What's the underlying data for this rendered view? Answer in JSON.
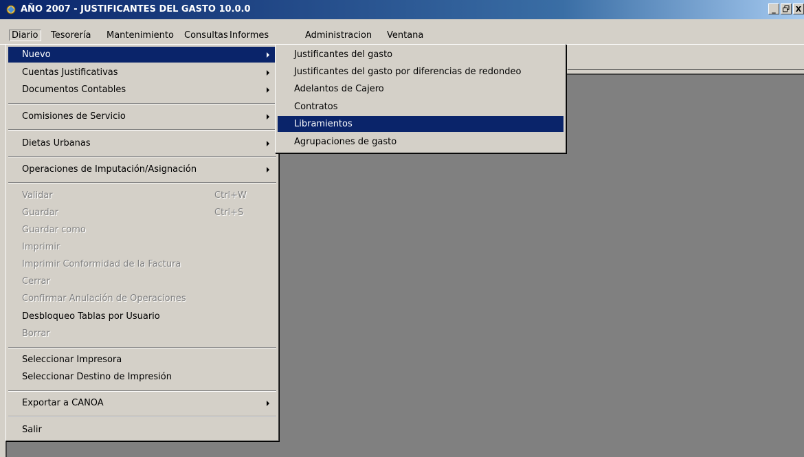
{
  "window": {
    "title": "AÑO 2007 - JUSTIFICANTES DEL GASTO 10.0.0",
    "controls": [
      "_",
      "И",
      "X"
    ]
  },
  "menubar": {
    "items": [
      "Diario",
      "Tesorería",
      "Mantenimiento",
      "Consultas",
      "Informes",
      "Administracion",
      "Ventana"
    ]
  },
  "diario_menu": {
    "items": [
      {
        "label": "Nuevo",
        "submenu": true,
        "selected": true
      },
      {
        "label": "Cuentas Justificativas",
        "submenu": true
      },
      {
        "label": "Documentos Contables",
        "submenu": true
      },
      {
        "label": "Comisiones de Servicio",
        "submenu": true
      },
      {
        "label": "Dietas Urbanas",
        "submenu": true
      },
      {
        "label": "Operaciones de Imputación/Asignación",
        "submenu": true
      },
      {
        "label": "Validar",
        "shortcut": "Ctrl+W",
        "disabled": true
      },
      {
        "label": "Guardar",
        "shortcut": "Ctrl+S",
        "disabled": true
      },
      {
        "label": "Guardar como",
        "disabled": true
      },
      {
        "label": "Imprimir",
        "disabled": true
      },
      {
        "label": "Imprimir Conformidad de la Factura",
        "disabled": true
      },
      {
        "label": "Cerrar",
        "disabled": true
      },
      {
        "label": "Confirmar Anulación de Operaciones",
        "disabled": true
      },
      {
        "label": "Desbloqueo Tablas por Usuario"
      },
      {
        "label": "Borrar",
        "disabled": true
      },
      {
        "label": "Seleccionar Impresora"
      },
      {
        "label": "Seleccionar Destino de Impresión"
      },
      {
        "label": "Exportar a CANOA",
        "submenu": true
      },
      {
        "label": "Salir"
      }
    ]
  },
  "nuevo_submenu": {
    "items": [
      {
        "label": "Justificantes del gasto"
      },
      {
        "label": "Justificantes del gasto por diferencias de redondeo"
      },
      {
        "label": "Adelantos de Cajero"
      },
      {
        "label": "Contratos"
      },
      {
        "label": "Libramientos",
        "selected": true
      },
      {
        "label": "Agrupaciones de gasto"
      }
    ]
  }
}
